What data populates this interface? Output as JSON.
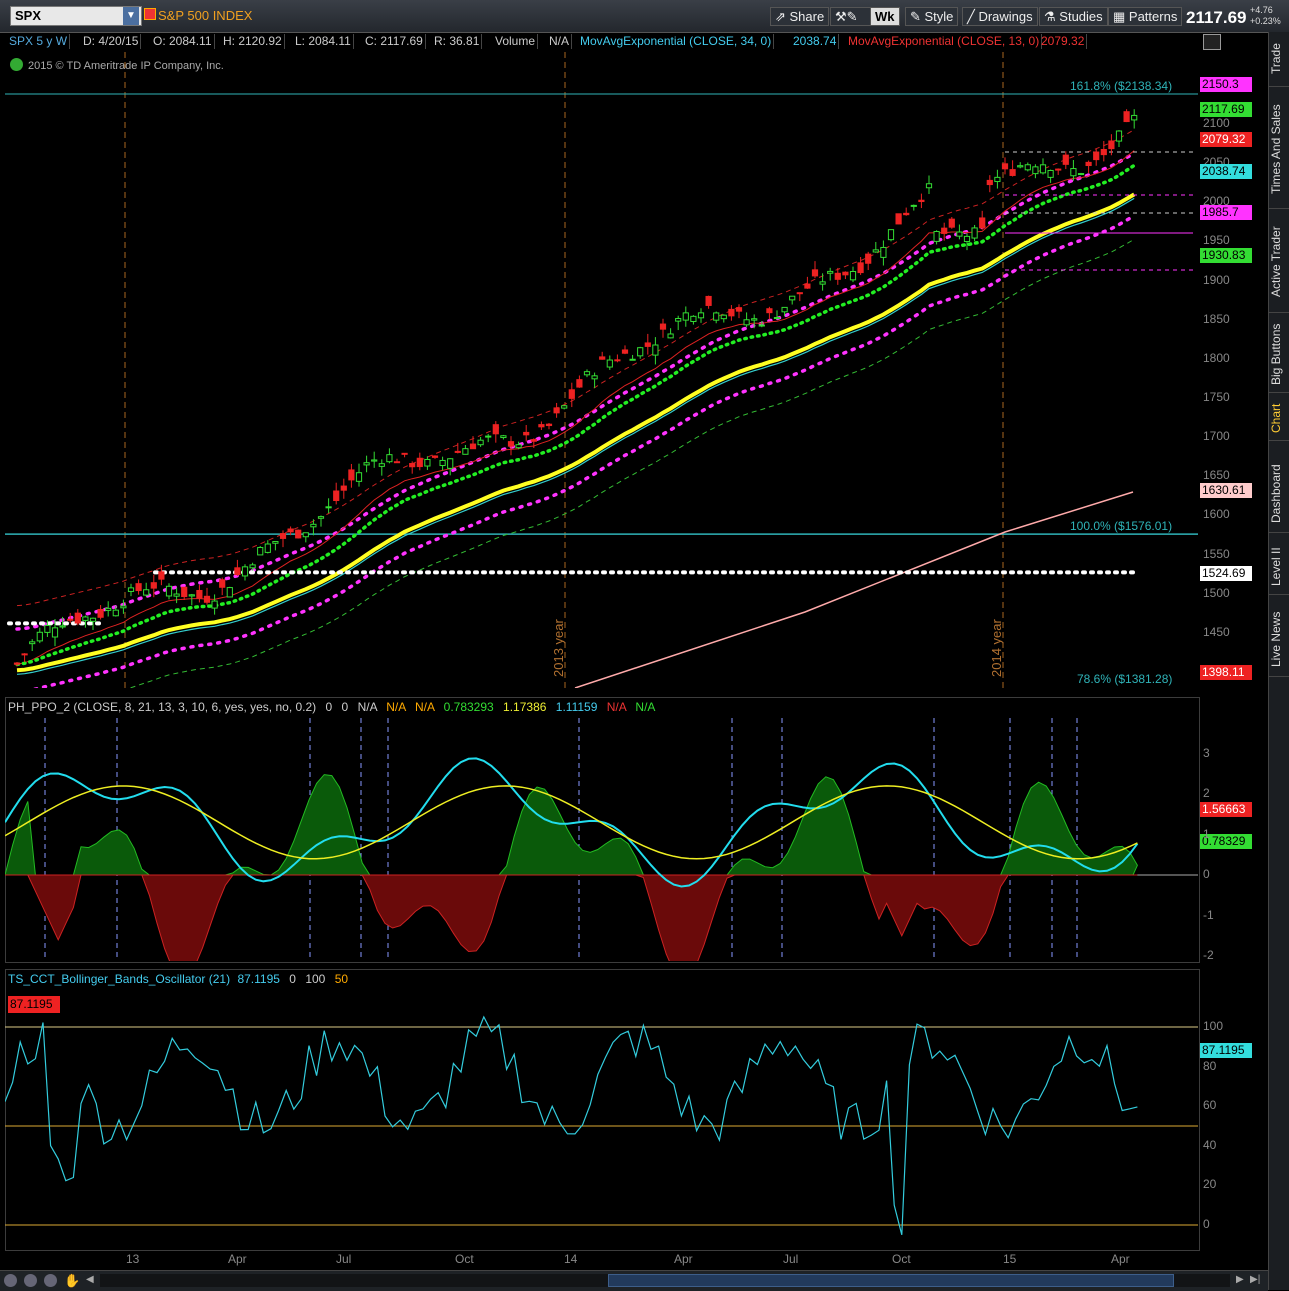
{
  "toolbar": {
    "symbol": "SPX",
    "index_name": "S&P 500 INDEX",
    "buttons": [
      "Share",
      "Wk",
      "Style",
      "Drawings",
      "Studies",
      "Patterns"
    ],
    "last_price": "2117.69",
    "change_abs": "+4.76",
    "change_pct": "+0.23%"
  },
  "info_line": {
    "chart_desc": "SPX 5 y W",
    "date": "D: 4/20/15",
    "open": "O: 2084.11",
    "high": "H: 2120.92",
    "low": "L: 2084.11",
    "close": "C: 2117.69",
    "range": "R: 36.81",
    "volume_label": "Volume",
    "volume_value": "N/A",
    "ema34_label": "MovAvgExponential (CLOSE, 34, 0)",
    "ema34_value": "2038.74",
    "ema13_label": "MovAvgExponential (CLOSE, 13, 0)",
    "ema13_value": "2079.32"
  },
  "copyright": "2015 © TD Ameritrade IP Company, Inc.",
  "side_tabs": [
    "Trade",
    "Times And Sales",
    "Active Trader",
    "Big Buttons",
    "Chart",
    "Dashboard",
    "Level II",
    "Live News"
  ],
  "fib_labels": {
    "f1618": "161.8%  ($2138.34)",
    "f1000": "100.0%  ($1576.01)",
    "f786": "78.6%  ($1381.28)"
  },
  "year_labels": [
    "2013 year",
    "2014 year"
  ],
  "price_tags": [
    {
      "text": "2150.3",
      "color": "#ff33ff",
      "y": 2150.3
    },
    {
      "text": "2117.69",
      "color": "#33dd33",
      "y": 2117.69
    },
    {
      "text": "2079.32",
      "color": "#ee2222",
      "y": 2079.32
    },
    {
      "text": "2038.74",
      "color": "#33dddd",
      "y": 2038.74
    },
    {
      "text": "1985.7",
      "color": "#ff33ff",
      "y": 1985.7
    },
    {
      "text": "1930.83",
      "color": "#33dd33",
      "y": 1930.83
    },
    {
      "text": "1630.61",
      "color": "#ffcccc",
      "y": 1630.61
    },
    {
      "text": "1524.69",
      "color": "#ffffff",
      "y": 1524.69
    },
    {
      "text": "1398.11",
      "color": "#ee2222",
      "y": 1398.11
    }
  ],
  "price_axis": [
    "2100",
    "2050",
    "2000",
    "1950",
    "1900",
    "1850",
    "1800",
    "1750",
    "1700",
    "1650",
    "1600",
    "1550",
    "1500",
    "1450"
  ],
  "ppo_panel": {
    "title": "PH_PPO_2 (CLOSE, 8, 21, 13, 3, 10, 6, yes, yes, no, 0.2)",
    "fields": [
      "0",
      "0",
      "N/A",
      "N/A",
      "N/A",
      "0.783293",
      "1.17386",
      "1.11159",
      "N/A",
      "N/A"
    ],
    "tags": [
      {
        "text": "1.56663",
        "color": "#ee2222"
      },
      {
        "text": "0.78329",
        "color": "#33dd33"
      }
    ],
    "axis": [
      "3",
      "2",
      "1",
      "0",
      "-1",
      "-2"
    ]
  },
  "bbo_panel": {
    "title": "TS_CCT_Bollinger_Bands_Oscillator (21)",
    "fields": [
      "87.1195",
      "0",
      "100",
      "50"
    ],
    "tag_left": "87.1195",
    "tag_right": "87.1195",
    "axis": [
      "100",
      "80",
      "60",
      "40",
      "20",
      "0"
    ]
  },
  "time_axis": [
    "13",
    "Apr",
    "Jul",
    "Oct",
    "14",
    "Apr",
    "Jul",
    "Oct",
    "15",
    "Apr"
  ]
}
